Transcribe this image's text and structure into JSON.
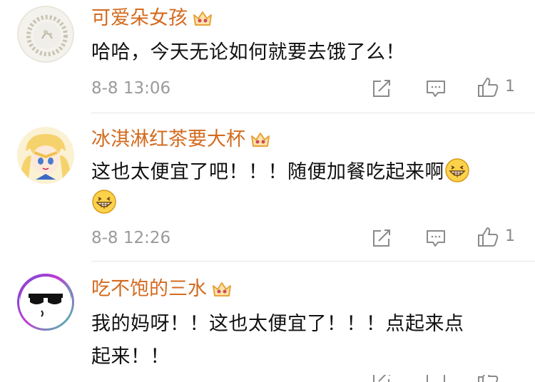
{
  "comments": [
    {
      "username": "可爱朵女孩",
      "text_parts": [
        "哈哈，今天无论如何就要去饿了么！"
      ],
      "timestamp": "8-8 13:06",
      "like_count": "1",
      "avatar": "floral-wreath-avatar",
      "badge": "crown-badge-icon"
    },
    {
      "username": "冰淇淋红茶要大杯",
      "text_parts": [
        "这也太便宜了吧！！！随便加餐吃起来啊"
      ],
      "emoji": "grinning-emoji",
      "timestamp": "8-8 12:26",
      "like_count": "1",
      "avatar": "sailor-moon-avatar",
      "badge": "crown-badge-icon"
    },
    {
      "username": "吃不饱的三水",
      "text_lines": [
        "我的妈呀！！这也太便宜了！！！点起来点",
        "起来！！"
      ],
      "avatar": "cool-sunglasses-avatar",
      "badge": "crown-badge-icon"
    }
  ],
  "icons": {
    "repost": "repost-icon",
    "comment": "comment-icon",
    "like": "thumbs-up-icon"
  },
  "colors": {
    "username": "#d36b1f",
    "timestamp": "#9a9a9a",
    "icon": "#8a8a8a",
    "crown": "#e8a23a"
  }
}
